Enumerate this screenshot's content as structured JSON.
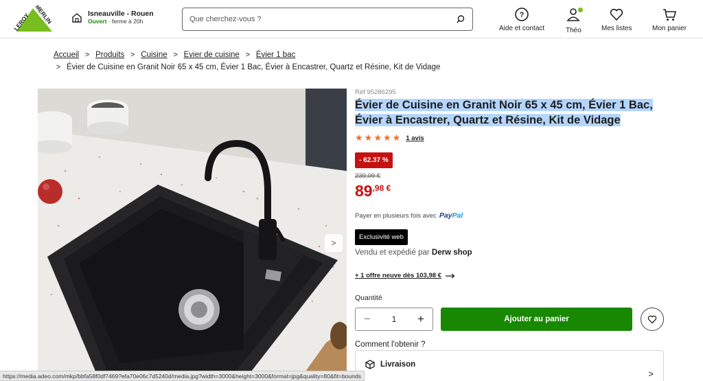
{
  "header": {
    "logo_text": "LEROY MERLIN",
    "store_name": "Isneauville - Rouen",
    "store_status": "Ouvert",
    "store_hours": " · ferme à 20h",
    "search_placeholder": "Que cherchez-vous ?",
    "nav": {
      "help": "Aide et contact",
      "account": "Théo",
      "lists": "Mes listes",
      "cart": "Mon panier"
    }
  },
  "breadcrumb": {
    "items": [
      "Accueil",
      "Produits",
      "Cuisine",
      "Evier de cuisine",
      "Évier 1 bac"
    ],
    "current": "Évier de Cuisine en Granit Noir 65 x 45 cm, Évier 1 Bac, Évier à Encastrer, Quartz et Résine, Kit de Vidage"
  },
  "product": {
    "ref": "Réf 95286295",
    "title_line1": "Évier de Cuisine en Granit Noir 65 x 45 cm, Évier 1 Bac,",
    "title_line2": "Évier à Encastrer, Quartz et Résine, Kit de Vidage",
    "rating": 5,
    "reviews": "1 avis",
    "discount": "- 62.37 %",
    "old_price": "239,09 €",
    "price_int": "89",
    "price_dec": ",98 €",
    "payment_text": "Payer en plusieurs fois avec",
    "paypal_pay": "Pay",
    "paypal_pal": "Pal",
    "exclusive": "Exclusivité web",
    "sold_prefix": "Vendu et expédié par",
    "seller": "Derw shop",
    "offer": "+ 1 offre neuve dès 103,98 €",
    "quantity_label": "Quantité",
    "quantity": "1",
    "add_to_cart": "Ajouter au panier",
    "how_to_get": "Comment l'obtenir ?",
    "delivery": "Livraison"
  },
  "statusbar": {
    "url": "https://media.adeo.com/mkp/bbfa58f0df7469?efa70e06c7d5240d/media.jpg?width=3000&height=3000&format=jpg&quality=80&fit=bounds"
  },
  "colors": {
    "brand_green": "#188803",
    "accent_green": "#78be20",
    "price_red": "#c61112",
    "star_orange": "#f56b1d",
    "selection_blue": "#b4d5fe"
  }
}
